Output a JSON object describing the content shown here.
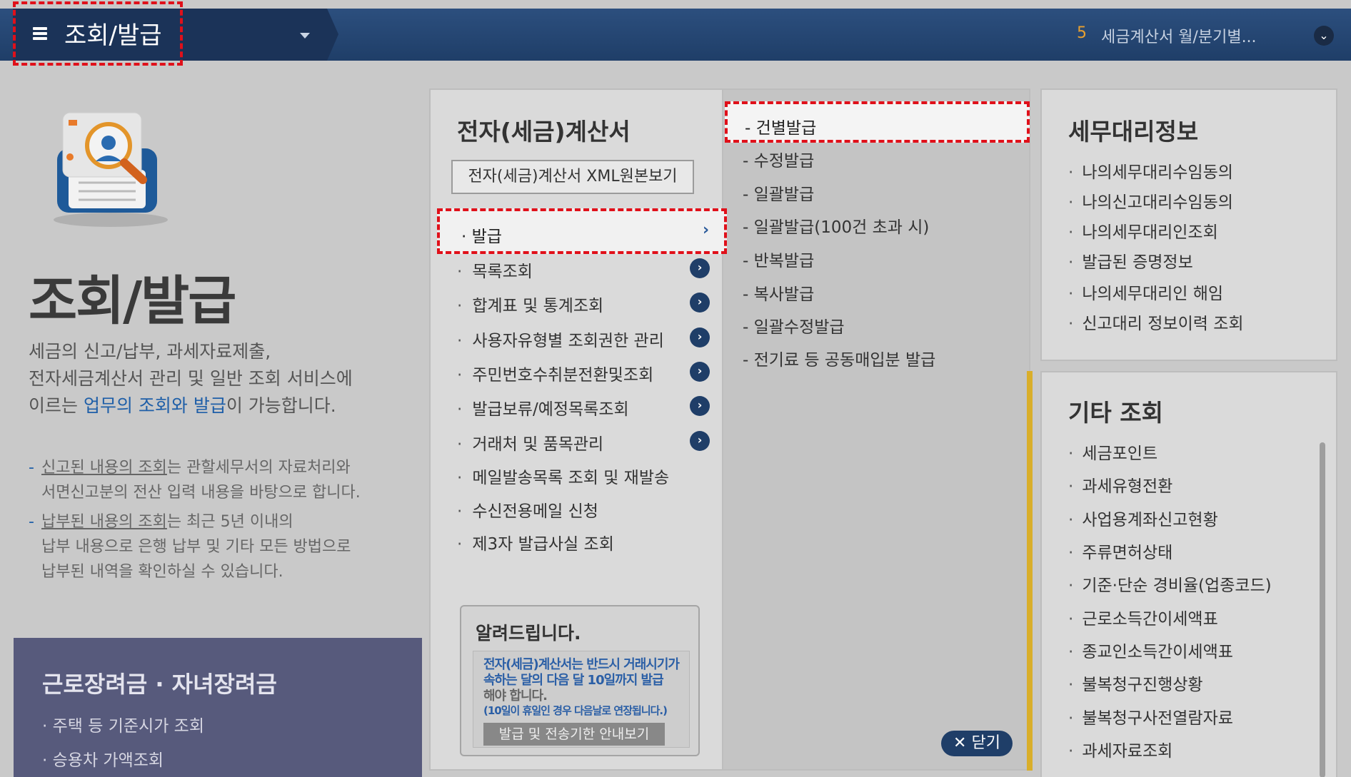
{
  "header": {
    "menu_title": "조회/발급",
    "recent_num": "5",
    "recent_text": "세금계산서 월/분기별..."
  },
  "left": {
    "title": "조회/발급",
    "desc_line1": "세금의 신고/납부, 과세자료제출,",
    "desc_line2": "전자세금계산서 관리 및 일반 조회 서비스에",
    "desc_line3_pre": "이르는 ",
    "desc_line3_hl": "업무의 조회와 발급",
    "desc_line3_post": "이 가능합니다.",
    "note1_u": "신고된 내용의 조회",
    "note1_rest": "는 관할세무서의 자료처리와",
    "note1_line2": "서면신고분의 전산 입력 내용을 바탕으로 합니다.",
    "note2_u": "납부된 내용의 조회",
    "note2_rest": "는 최근 5년 이내의",
    "note2_line2": "납부 내용으로 은행 납부 및 기타 모든 방법으로",
    "note2_line3": "납부된 내역을 확인하실 수 있습니다."
  },
  "promo": {
    "title": "근로장려금 · 자녀장려금",
    "items": [
      "주택 등 기준시가 조회",
      "승용차 가액조회"
    ]
  },
  "center": {
    "title": "전자(세금)계산서",
    "xml_button": "전자(세금)계산서 XML원본보기",
    "selected": "발급",
    "items": [
      "목록조회",
      "합계표 및 통계조회",
      "사용자유형별 조회권한 관리",
      "주민번호수취분전환및조회",
      "발급보류/예정목록조회",
      "거래처 및 품목관리",
      "메일발송목록 조회 및 재발송",
      "수신전용메일 신청",
      "제3자 발급사실 조회"
    ],
    "notice": {
      "title": "알려드립니다.",
      "line1": "전자(세금)계산서는 반드시 거래시기가",
      "line2": "속하는 달의 다음 달 10일까지 발급",
      "line3": "해야 합니다.",
      "line4": "(10일이 휴일인 경우 다음날로 연장됩니다.)",
      "button": "발급 및 전송기한 안내보기"
    }
  },
  "submenu": {
    "selected": "- 건별발급",
    "items": [
      "- 수정발급",
      "- 일괄발급",
      "- 일괄발급(100건 초과 시)",
      "- 반복발급",
      "- 복사발급",
      "- 일괄수정발급",
      "- 전기료 등 공동매입분 발급"
    ],
    "close": "✕ 닫기"
  },
  "right_top": {
    "title": "세무대리정보",
    "items": [
      "나의세무대리수임동의",
      "나의신고대리수임동의",
      "나의세무대리인조회",
      "발급된 증명정보",
      "나의세무대리인 해임",
      "신고대리 정보이력 조회"
    ]
  },
  "right_bottom": {
    "title": "기타 조회",
    "items": [
      "세금포인트",
      "과세유형전환",
      "사업용계좌신고현황",
      "주류면허상태",
      "기준·단순 경비율(업종코드)",
      "근로소득간이세액표",
      "종교인소득간이세액표",
      "불복청구진행상황",
      "불복청구사전열람자료",
      "과세자료조회"
    ]
  },
  "icons": {
    "hamburger": "hamburger-icon",
    "caret": "chevron-down-icon",
    "recent_toggle": "chevron-down-circle-icon",
    "item_arrow": "chevron-right-icon",
    "close": "close-icon"
  },
  "colors": {
    "header_bg": "#1f3e68",
    "highlight_red": "#e0101a",
    "link_blue": "#1f5fa8",
    "accent_yellow": "#d9ae2a",
    "recent_num": "#e8a030"
  }
}
